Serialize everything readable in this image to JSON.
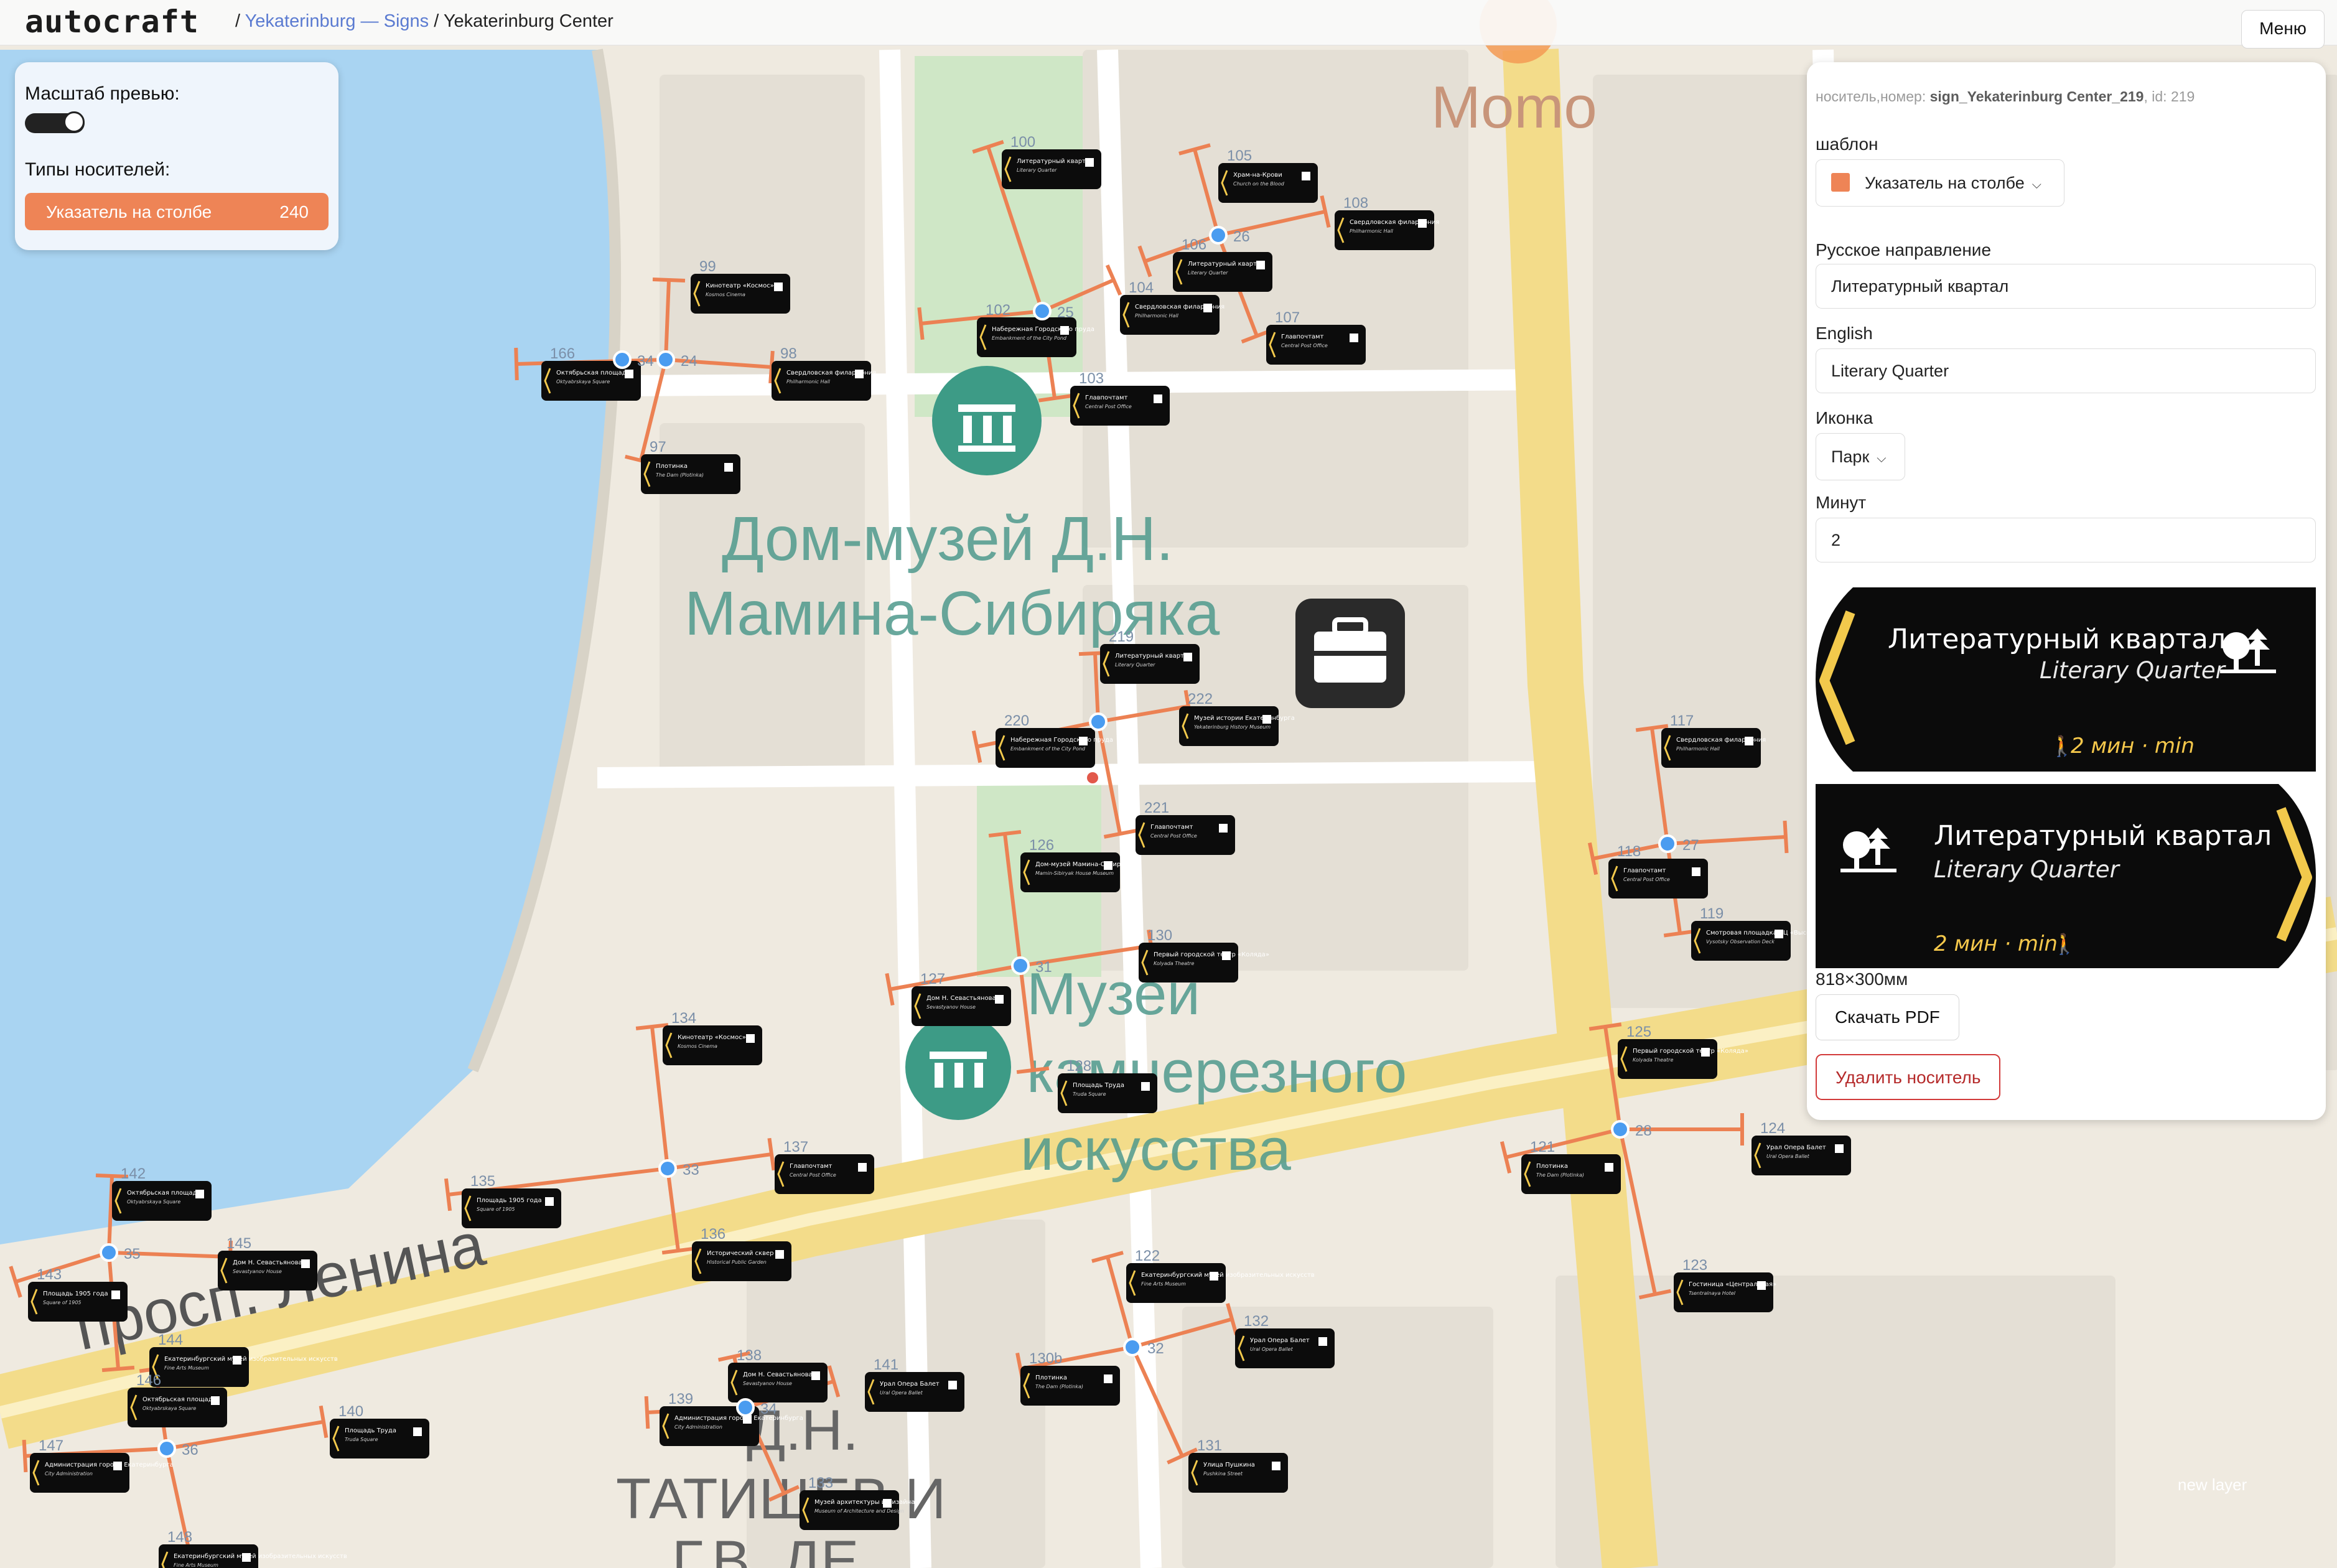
{
  "app": {
    "logo": "autocraft",
    "breadcrumb_sep1": "/",
    "breadcrumb_city": "Yekaterinburg — Signs",
    "breadcrumb_sep2": "/",
    "breadcrumb_current": "Yekaterinburg Center",
    "menu_label": "Меню"
  },
  "left_panel": {
    "preview_scale_label": "Масштаб превью:",
    "carrier_types_label": "Типы носителей:",
    "carrier_type_name": "Указатель на столбе",
    "carrier_type_count": "240"
  },
  "map": {
    "labels": {
      "momo": "Momo",
      "museum1_line1": "Дом-музей Д.Н.",
      "museum1_line2": "Мамина-Сибиряка",
      "museum2_line1": "Музей",
      "museum2_line2": "камнерезного",
      "museum2_line3": "искусства",
      "street": "просп. Ленина",
      "tatischev_line1": "Д.Н.",
      "tatischev_line2": "ТАТИЩЕВ И",
      "tatischev_line3": "Г.В. ДЕ"
    },
    "colors": {
      "route": "#ec8153",
      "node": "#4a9cf0",
      "sign": "#0c0c0c",
      "arrow_yellow": "#f2c94c"
    },
    "node_ids": [
      "25",
      "26",
      "24",
      "34",
      "27",
      "31",
      "28",
      "33",
      "35",
      "32",
      "34",
      "36"
    ],
    "signs": [
      {
        "id": "100",
        "title": "Литературный квартал",
        "en": "Literary Quarter"
      },
      {
        "id": "105",
        "title": "Храм-на-Крови",
        "en": "Church on the Blood"
      },
      {
        "id": "108",
        "title": "Свердловская филармония",
        "en": "Philharmonic Hall"
      },
      {
        "id": "106",
        "title": "Литературный квартал",
        "en": "Literary Quarter"
      },
      {
        "id": "104",
        "title": "Свердловская филармония",
        "en": "Philharmonic Hall"
      },
      {
        "id": "107",
        "title": "Главпочтамт",
        "en": "Central Post Office"
      },
      {
        "id": "99",
        "title": "Кинотеатр «Космос»",
        "en": "Kosmos Cinema"
      },
      {
        "id": "102",
        "title": "Набережная Городского пруда",
        "en": "Embankment of the City Pond"
      },
      {
        "id": "103",
        "title": "Главпочтамт",
        "en": "Central Post Office"
      },
      {
        "id": "166",
        "title": "Октябрьская площадь",
        "en": "Oktyabrskaya Square"
      },
      {
        "id": "98",
        "title": "Свердловская филармония",
        "en": "Philharmonic Hall"
      },
      {
        "id": "97",
        "title": "Плотинка",
        "en": "The Dam (Plotinka)"
      },
      {
        "id": "219",
        "title": "Литературный квартал",
        "en": "Literary Quarter"
      },
      {
        "id": "222",
        "title": "Музей истории Екатеринбурга",
        "en": "Yekaterinburg History Museum"
      },
      {
        "id": "220",
        "title": "Набережная Городского пруда",
        "en": "Embankment of the City Pond"
      },
      {
        "id": "221",
        "title": "Главпочтамт",
        "en": "Central Post Office"
      },
      {
        "id": "126",
        "title": "Дом-музей Мамина-Сибиряка",
        "en": "Mamin-Sibiryak House Museum"
      },
      {
        "id": "117",
        "title": "Свердловская филармония",
        "en": "Philharmonic Hall"
      },
      {
        "id": "118",
        "title": "Главпочтамт",
        "en": "Central Post Office"
      },
      {
        "id": "119",
        "title": "Смотровая площадка БЦ «Высоцкий»",
        "en": "Vysotsky Observation Deck"
      },
      {
        "id": "130",
        "title": "Первый городской театр «Коляда»",
        "en": "Kolyada Theatre"
      },
      {
        "id": "127",
        "title": "Дом Н. Севастьянова",
        "en": "Sevastyanov House"
      },
      {
        "id": "128",
        "title": "Площадь Труда",
        "en": "Truda Square"
      },
      {
        "id": "134",
        "title": "Кинотеатр «Космос»",
        "en": "Kosmos Cinema"
      },
      {
        "id": "125",
        "title": "Первый городской театр «Коляда»",
        "en": "Kolyada Theatre"
      },
      {
        "id": "124",
        "title": "Урал Опера Балет",
        "en": "Ural Opera Ballet"
      },
      {
        "id": "121",
        "title": "Плотинка",
        "en": "The Dam (Plotinka)"
      },
      {
        "id": "137",
        "title": "Главпочтамт",
        "en": "Central Post Office"
      },
      {
        "id": "135",
        "title": "Площадь 1905 года",
        "en": "Square of 1905"
      },
      {
        "id": "136",
        "title": "Исторический сквер",
        "en": "Historical Public Garden"
      },
      {
        "id": "142",
        "title": "Октябрьская площадь",
        "en": "Oktyabrskaya Square"
      },
      {
        "id": "145",
        "title": "Дом Н. Севастьянова",
        "en": "Sevastyanov House"
      },
      {
        "id": "143",
        "title": "Площадь 1905 года",
        "en": "Square of 1905"
      },
      {
        "id": "144",
        "title": "Екатеринбургский музей изобразительных искусств",
        "en": "Fine Arts Museum"
      },
      {
        "id": "146",
        "title": "Октябрьская площадь",
        "en": "Oktyabrskaya Square"
      },
      {
        "id": "122",
        "title": "Екатеринбургский музей изобразительных искусств",
        "en": "Fine Arts Museum"
      },
      {
        "id": "123",
        "title": "Гостиница «Центральная»",
        "en": "Tsentralnaya Hotel"
      },
      {
        "id": "132",
        "title": "Урал Опера Балет",
        "en": "Ural Opera Ballet"
      },
      {
        "id": "130b",
        "title": "Плотинка",
        "en": "The Dam (Plotinka)"
      },
      {
        "id": "138",
        "title": "Дом Н. Севастьянова",
        "en": "Sevastyanov House"
      },
      {
        "id": "141",
        "title": "Урал Опера Балет",
        "en": "Ural Opera Ballet"
      },
      {
        "id": "139",
        "title": "Администрация города Екатеринбурга",
        "en": "City Administration"
      },
      {
        "id": "140",
        "title": "Площадь Труда",
        "en": "Truda Square"
      },
      {
        "id": "147",
        "title": "Администрация города Екатеринбурга",
        "en": "City Administration"
      },
      {
        "id": "131",
        "title": "Улица Пушкина",
        "en": "Pushkina Street"
      },
      {
        "id": "133",
        "title": "Музей архитектуры и дизайна",
        "en": "Museum of Architecture and Design"
      },
      {
        "id": "148",
        "title": "Екатеринбургский музей изобразительных искусств",
        "en": "Fine Arts Museum"
      }
    ],
    "watermark": "new layer"
  },
  "right_panel": {
    "meta_prefix": "носитель,номер:",
    "meta_name": "sign_Yekaterinburg Center_219",
    "meta_id": ", id: 219",
    "template_label": "шаблон",
    "template_value": "Указатель на столбе",
    "ru_direction_label": "Русское направление",
    "ru_direction_value": "Литературный квартал",
    "english_label": "English",
    "english_value": "Literary Quarter",
    "icon_label": "Иконка",
    "icon_value": "Парк",
    "minutes_label": "Минут",
    "minutes_value": "2",
    "preview": {
      "ru": "Литературный квартал",
      "en": "Literary Quarter",
      "minutes": "2 мин · min",
      "icon": "park-icon"
    },
    "size_label": "818×300мм",
    "download_label": "Скачать PDF",
    "delete_label": "Удалить носитель"
  }
}
